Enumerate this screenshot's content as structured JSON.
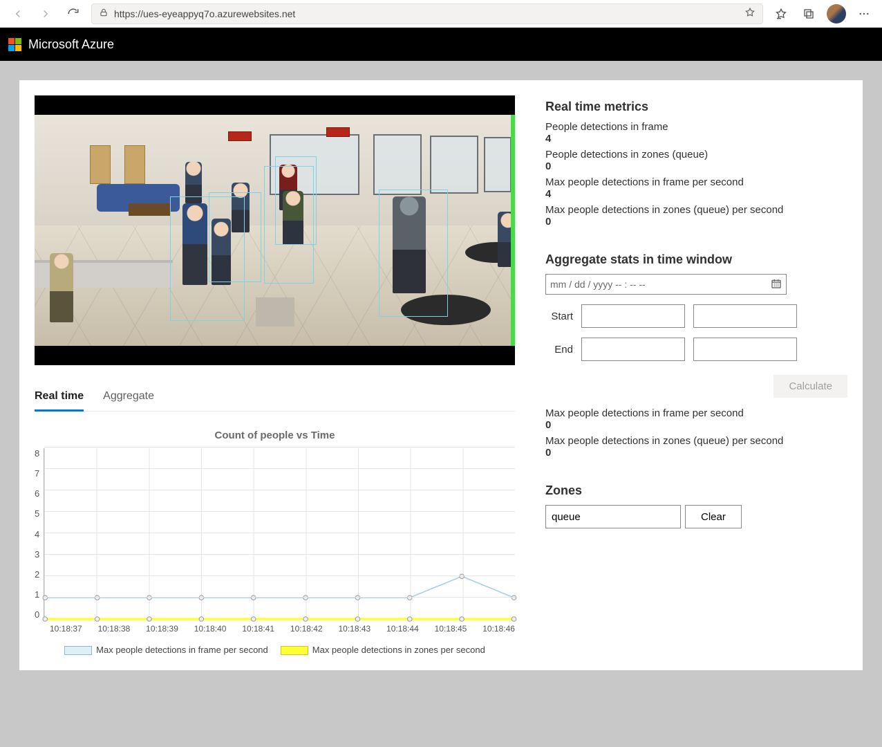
{
  "browser": {
    "url": "https://ues-eyeappyq7o.azurewebsites.net"
  },
  "header": {
    "product": "Microsoft Azure"
  },
  "tabs": {
    "realtime": "Real time",
    "aggregate": "Aggregate"
  },
  "metrics": {
    "heading": "Real time metrics",
    "frame_label": "People detections in frame",
    "frame_value": "4",
    "zones_label": "People detections in zones (queue)",
    "zones_value": "0",
    "max_frame_label": "Max people detections in frame per second",
    "max_frame_value": "4",
    "max_zones_label": "Max people detections in zones (queue) per second",
    "max_zones_value": "0"
  },
  "aggregate": {
    "heading": "Aggregate stats in time window",
    "date_placeholder": "mm / dd / yyyy   -- : --   --",
    "start_label": "Start",
    "end_label": "End",
    "calculate": "Calculate",
    "out_max_frame_label": "Max people detections in frame per second",
    "out_max_frame_value": "0",
    "out_max_zones_label": "Max people detections in zones (queue) per second",
    "out_max_zones_value": "0"
  },
  "zones": {
    "heading": "Zones",
    "value": "queue",
    "clear": "Clear"
  },
  "chart_data": {
    "type": "line",
    "title": "Count of people vs Time",
    "xlabel": "",
    "ylabel": "",
    "ylim": [
      0,
      8
    ],
    "categories": [
      "10:18:37",
      "10:18:38",
      "10:18:39",
      "10:18:40",
      "10:18:41",
      "10:18:42",
      "10:18:43",
      "10:18:44",
      "10:18:45",
      "10:18:46"
    ],
    "series": [
      {
        "name": "Max people detections in frame per second",
        "color": "#a9cfe2",
        "values": [
          1,
          1,
          1,
          1,
          1,
          1,
          1,
          1,
          2,
          1
        ]
      },
      {
        "name": "Max people detections in zones per second",
        "color": "#ffff33",
        "values": [
          0,
          0,
          0,
          0,
          0,
          0,
          0,
          0,
          0,
          0
        ]
      }
    ]
  }
}
